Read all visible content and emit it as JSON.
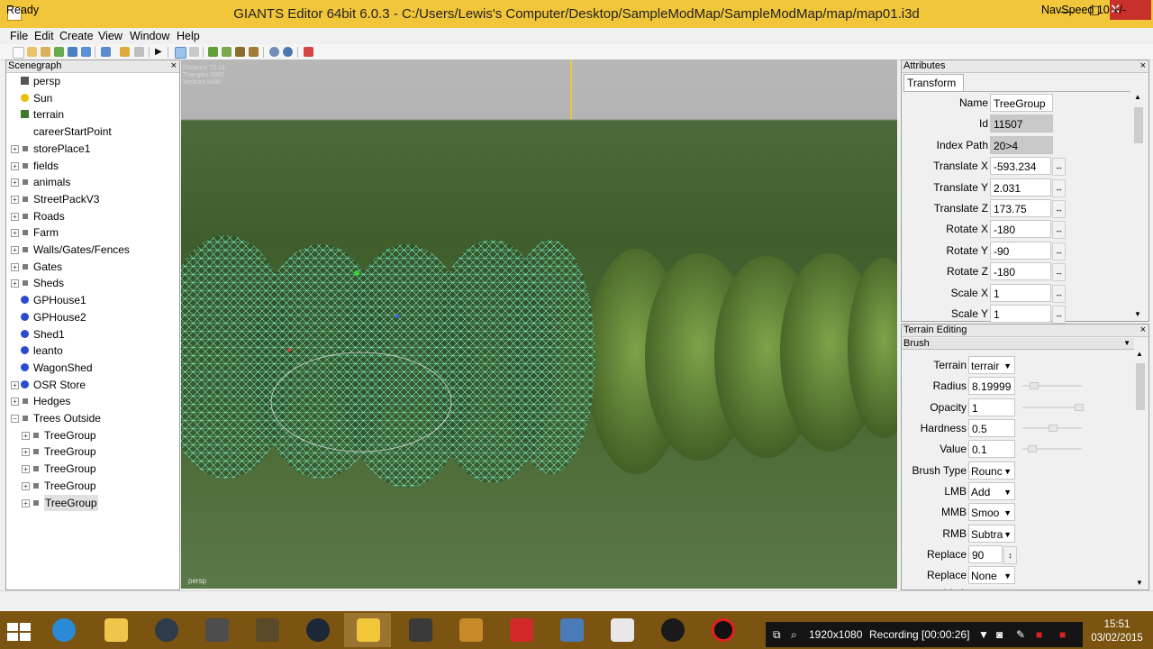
{
  "window": {
    "title": "GIANTS Editor 64bit 6.0.3 - C:/Users/Lewis's Computer/Desktop/SampleModMap/SampleModMap/map/map01.i3d",
    "minimize": "—",
    "maximize": "☐",
    "close": "✕"
  },
  "menu": [
    "File",
    "Edit",
    "Create",
    "View",
    "Window",
    "Help"
  ],
  "scenegraph": {
    "title": "Scenegraph",
    "close": "×",
    "items": [
      {
        "label": "persp",
        "icon": "camera-icon",
        "level": 0,
        "expandable": false
      },
      {
        "label": "Sun",
        "icon": "light-icon",
        "level": 0,
        "expandable": false
      },
      {
        "label": "terrain",
        "icon": "terrain-icon",
        "level": 0,
        "expandable": false
      },
      {
        "label": "careerStartPoint",
        "icon": "none",
        "level": 0,
        "expandable": false
      },
      {
        "label": "storePlace1",
        "icon": "transform-group-icon",
        "level": 0,
        "expandable": true
      },
      {
        "label": "fields",
        "icon": "transform-group-icon",
        "level": 0,
        "expandable": true
      },
      {
        "label": "animals",
        "icon": "transform-group-icon",
        "level": 0,
        "expandable": true
      },
      {
        "label": "StreetPackV3",
        "icon": "transform-group-icon",
        "level": 0,
        "expandable": true
      },
      {
        "label": "Roads",
        "icon": "transform-group-icon",
        "level": 0,
        "expandable": true
      },
      {
        "label": "Farm",
        "icon": "transform-group-icon",
        "level": 0,
        "expandable": true
      },
      {
        "label": "Walls/Gates/Fences",
        "icon": "transform-group-icon",
        "level": 0,
        "expandable": true
      },
      {
        "label": "Gates",
        "icon": "transform-group-icon",
        "level": 0,
        "expandable": true
      },
      {
        "label": "Sheds",
        "icon": "transform-group-icon",
        "level": 0,
        "expandable": true
      },
      {
        "label": "GPHouse1",
        "icon": "shape-icon",
        "level": 0,
        "expandable": false
      },
      {
        "label": "GPHouse2",
        "icon": "shape-icon",
        "level": 0,
        "expandable": false
      },
      {
        "label": "Shed1",
        "icon": "shape-icon",
        "level": 0,
        "expandable": false
      },
      {
        "label": "leanto",
        "icon": "shape-icon",
        "level": 0,
        "expandable": false
      },
      {
        "label": "WagonShed",
        "icon": "shape-icon",
        "level": 0,
        "expandable": false
      },
      {
        "label": "OSR Store",
        "icon": "shape-icon",
        "level": 0,
        "expandable": true
      },
      {
        "label": "Hedges",
        "icon": "transform-group-icon",
        "level": 0,
        "expandable": true
      },
      {
        "label": "Trees Outside",
        "icon": "transform-group-icon",
        "level": 0,
        "expandable": true,
        "expanded": true
      },
      {
        "label": "TreeGroup",
        "icon": "transform-group-icon",
        "level": 1,
        "expandable": true
      },
      {
        "label": "TreeGroup",
        "icon": "transform-group-icon",
        "level": 1,
        "expandable": true
      },
      {
        "label": "TreeGroup",
        "icon": "transform-group-icon",
        "level": 1,
        "expandable": true
      },
      {
        "label": "TreeGroup",
        "icon": "transform-group-icon",
        "level": 1,
        "expandable": true
      },
      {
        "label": "TreeGroup",
        "icon": "transform-group-icon",
        "level": 1,
        "expandable": true,
        "selected": true
      }
    ]
  },
  "viewport": {
    "hud": [
      "Distance 72.13",
      "Triangles 6085",
      "Vertices 5490"
    ],
    "camera_label": "persp"
  },
  "attributes": {
    "title": "Attributes",
    "close": "×",
    "tab": "Transform",
    "fields": [
      {
        "label": "Name",
        "value": "TreeGroup",
        "readonly": false,
        "spin": false
      },
      {
        "label": "Id",
        "value": "11507",
        "readonly": true,
        "spin": false
      },
      {
        "label": "Index Path",
        "value": "20>4",
        "readonly": true,
        "spin": false
      },
      {
        "label": "Translate X",
        "value": "-593.234",
        "readonly": false,
        "spin": true
      },
      {
        "label": "Translate Y",
        "value": "2.031",
        "readonly": false,
        "spin": true
      },
      {
        "label": "Translate Z",
        "value": "173.75",
        "readonly": false,
        "spin": true
      },
      {
        "label": "Rotate X",
        "value": "-180",
        "readonly": false,
        "spin": true
      },
      {
        "label": "Rotate Y",
        "value": "-90",
        "readonly": false,
        "spin": true
      },
      {
        "label": "Rotate Z",
        "value": "-180",
        "readonly": false,
        "spin": true
      },
      {
        "label": "Scale X",
        "value": "1",
        "readonly": false,
        "spin": true
      },
      {
        "label": "Scale Y",
        "value": "1",
        "readonly": false,
        "spin": true
      }
    ]
  },
  "terrain_editing": {
    "title": "Terrain Editing",
    "close": "×",
    "section": "Brush",
    "terrain": {
      "label": "Terrain",
      "value": "terrair"
    },
    "radius": {
      "label": "Radius",
      "value": "8.19999"
    },
    "opacity": {
      "label": "Opacity",
      "value": "1"
    },
    "hardness": {
      "label": "Hardness",
      "value": "0.5"
    },
    "value": {
      "label": "Value",
      "value": "0.1"
    },
    "brush_type": {
      "label": "Brush Type",
      "value": "Rounc"
    },
    "lmb": {
      "label": "LMB",
      "value": "Add"
    },
    "mmb": {
      "label": "MMB",
      "value": "Smoo"
    },
    "rmb": {
      "label": "RMB",
      "value": "Subtra"
    },
    "replace": {
      "label": "Replace",
      "value": "90"
    },
    "replace_limit": {
      "label": "Replace Limit",
      "value": "None"
    }
  },
  "status": {
    "text": "Ready",
    "navspeed": "NavSpeed 10 +/-"
  },
  "recording": {
    "resolution": "1920x1080",
    "status": "Recording [00:00:26]"
  },
  "clock": {
    "time": "15:51",
    "date": "03/02/2015"
  },
  "colors": {
    "titlebar": "#f2c63a",
    "selection_wireframe": "#6fe3b5",
    "taskbar": "#7a5410"
  }
}
